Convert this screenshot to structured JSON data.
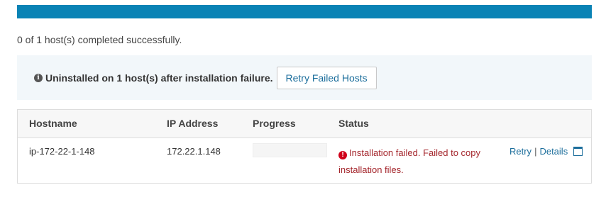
{
  "progress": {
    "percent": 100,
    "color": "#0a83b5"
  },
  "summary": "0 of 1 host(s) completed successfully.",
  "alert": {
    "icon": "info-circle-icon",
    "message": "Uninstalled on 1 host(s) after installation failure.",
    "button_label": "Retry Failed Hosts"
  },
  "table": {
    "headers": {
      "hostname": "Hostname",
      "ip": "IP Address",
      "progress": "Progress",
      "status": "Status"
    },
    "rows": [
      {
        "hostname": "ip-172-22-1-148",
        "ip": "172.22.1.148",
        "progress_percent": 0,
        "status_icon": "error-circle-icon",
        "status": "Installation failed. Failed to copy installation files.",
        "status_color": "#a4262c",
        "retry_label": "Retry",
        "separator": "|",
        "details_label": "Details"
      }
    ]
  }
}
